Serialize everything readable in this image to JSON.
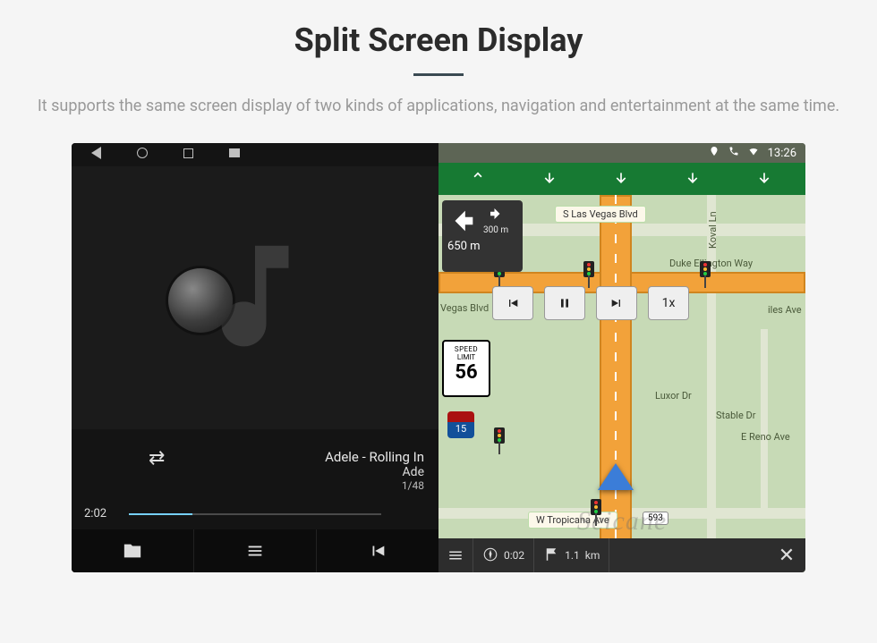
{
  "title": "Split Screen Display",
  "subtitle": "It supports the same screen display of two kinds of applications, navigation and entertainment at the same time.",
  "status": {
    "time": "13:26"
  },
  "music": {
    "track_line1": "Adele - Rolling In",
    "track_line2": "Ade",
    "counter": "1/48",
    "elapsed": "2:02"
  },
  "nav": {
    "street_top": "S Las Vegas Blvd",
    "street_bottom": "W Tropicana Ave",
    "street_bottom_num": "593",
    "turn": {
      "main_dist": "650",
      "main_unit": "m",
      "next_dist": "300",
      "next_unit": "m"
    },
    "controls": {
      "speed": "1x"
    },
    "speed_sign": {
      "l1": "SPEED",
      "l2": "LIMIT",
      "value": "56"
    },
    "hwy_shield": "15",
    "poi": {
      "vegas_blvd": "Vegas Blvd",
      "koval": "Koval Ln",
      "duke": "Duke Ellington Way",
      "luxor": "Luxor Dr",
      "stable": "Stable Dr",
      "reno": "E Reno Ave",
      "iles": "iles Ave"
    },
    "bottom": {
      "eta": "0:02",
      "dist": "1.1",
      "dist_unit": "km"
    }
  },
  "watermark": "Seicane"
}
